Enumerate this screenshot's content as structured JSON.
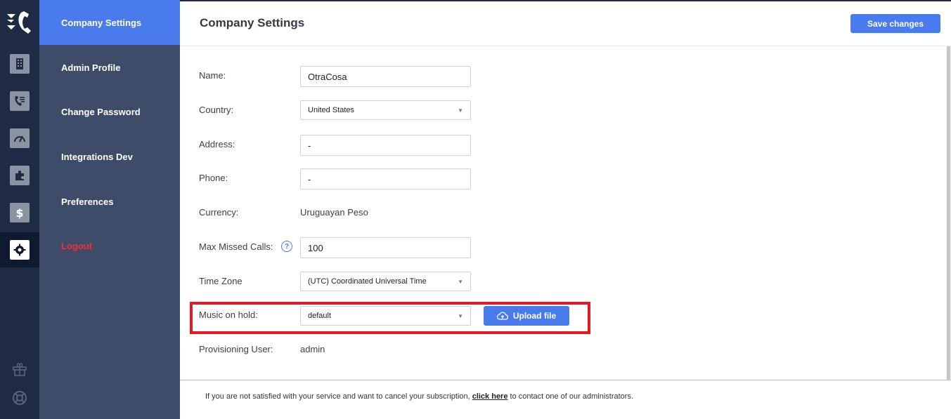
{
  "header": {
    "title": "Company Settings",
    "save_label": "Save changes"
  },
  "menu": {
    "items": [
      {
        "label": "Company Settings",
        "active": true
      },
      {
        "label": "Admin Profile"
      },
      {
        "label": "Change Password"
      },
      {
        "label": "Integrations Dev"
      },
      {
        "label": "Preferences"
      },
      {
        "label": "Logout"
      }
    ]
  },
  "rail": {
    "icons": [
      "building-icon",
      "phone-list-icon",
      "speedometer-icon",
      "puzzle-icon",
      "dollar-icon",
      "gear-icon"
    ],
    "bottom_icons": [
      "gift-icon",
      "lifebuoy-icon"
    ]
  },
  "form": {
    "name": {
      "label": "Name:",
      "value": "OtraCosa"
    },
    "country": {
      "label": "Country:",
      "value": "United States"
    },
    "address": {
      "label": "Address:",
      "value": "-"
    },
    "phone": {
      "label": "Phone:",
      "value": "-"
    },
    "currency": {
      "label": "Currency:",
      "value": "Uruguayan Peso"
    },
    "max_missed_calls": {
      "label": "Max Missed Calls:",
      "value": "100",
      "help": "?"
    },
    "time_zone": {
      "label": "Time Zone",
      "value": "(UTC) Coordinated Universal Time"
    },
    "music_on_hold": {
      "label": "Music on hold:",
      "value": "default",
      "upload_label": "Upload file"
    },
    "provisioning_user": {
      "label": "Provisioning User:",
      "value": "admin"
    }
  },
  "footer": {
    "text_before": "If you are not satisfied with your service and want to cancel your subscription, ",
    "link": "click here",
    "text_after": " to contact one of our administrators."
  },
  "colors": {
    "accent": "#4a7bec",
    "rail_bg": "#1f2a44",
    "menu_bg": "#3e4c6a",
    "logout": "#e8323c",
    "highlight": "#e01b24"
  }
}
